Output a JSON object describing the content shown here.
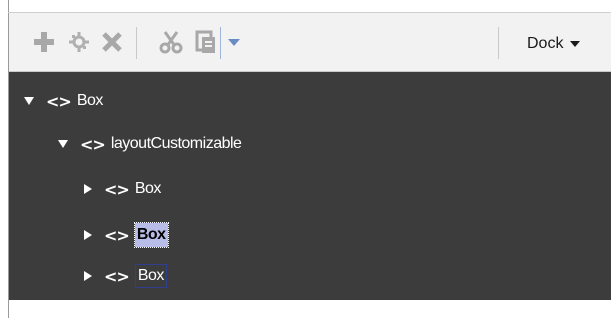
{
  "toolbar": {
    "buttons": [
      {
        "icon": "add-icon",
        "title": "Add"
      },
      {
        "icon": "wrap-icon",
        "title": "Wrap"
      },
      {
        "icon": "delete-icon",
        "title": "Delete"
      },
      {
        "icon": "cut-icon",
        "title": "Cut"
      },
      {
        "icon": "paste-icon",
        "title": "Paste"
      },
      {
        "icon": "dropdown-icon",
        "title": "More"
      }
    ],
    "dock_label": "Dock"
  },
  "tree": {
    "rows": [
      {
        "label": "Box",
        "expanded": true,
        "level": 0
      },
      {
        "label": "layoutCustomizable",
        "expanded": true,
        "level": 1
      },
      {
        "label": "Box",
        "expanded": false,
        "level": 2
      },
      {
        "label": "Box",
        "expanded": false,
        "level": 2,
        "selected": true
      },
      {
        "label": "Box",
        "expanded": false,
        "level": 2,
        "focused": true
      }
    ]
  },
  "colors": {
    "tree_background": "#3c3c3c",
    "toolbar_background": "#f2f2f2",
    "selection": "#b8bde8",
    "icon_disabled": "#a8a8a8",
    "icon_accent": "#6a8cc4"
  }
}
